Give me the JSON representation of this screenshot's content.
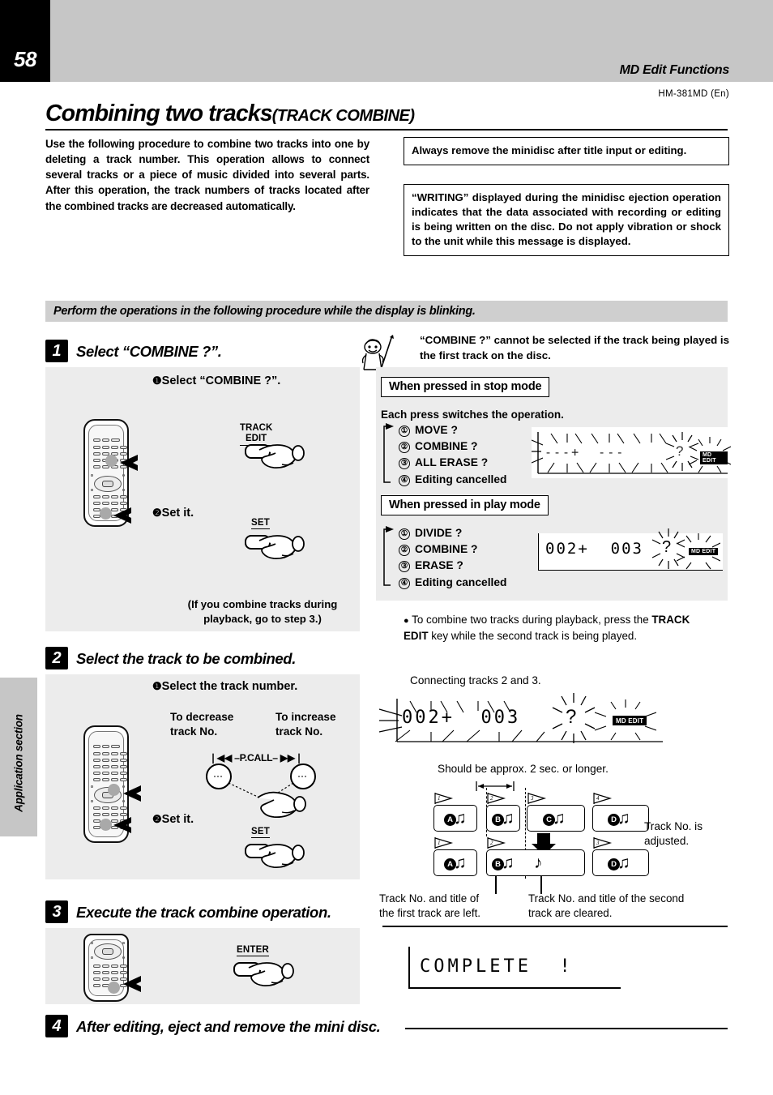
{
  "header": {
    "page_number": "58",
    "section_title": "MD Edit Functions",
    "model": "HM-381MD (En)"
  },
  "sidebar": {
    "label": "Application section"
  },
  "title": {
    "main": "Combining two tracks",
    "sub": "(TRACK COMBINE)"
  },
  "intro": "Use the following procedure to combine two tracks into one by deleting a track number. This operation allows to connect several tracks or a piece of music divided into several parts. After this operation, the track numbers of tracks located after the combined tracks are decreased automatically.",
  "notes": [
    "Always remove the minidisc after title input or editing.",
    "“WRITING” displayed during the minidisc ejection operation indicates that the data associated with recording or editing is being written on the disc. Do not apply vibration or shock to the unit while this message is displayed."
  ],
  "banner": "Perform the operations in the following procedure while the display is blinking.",
  "steps": [
    {
      "number": "1",
      "title": "Select “COMBINE ?”."
    },
    {
      "number": "2",
      "title": "Select the track to be combined."
    },
    {
      "number": "3",
      "title": "Execute the track combine operation."
    },
    {
      "number": "4",
      "title": "After editing, eject and remove the mini disc."
    }
  ],
  "step1": {
    "caution": "“COMBINE ?” cannot be selected if the track being played is the first track on the disc.",
    "sub1_num": "❶",
    "sub1": "Select “COMBINE ?”.",
    "sub2_num": "❷",
    "sub2": "Set it.",
    "key_track_edit_line1": "TRACK",
    "key_track_edit_line2": "EDIT",
    "key_set": "SET",
    "footnote": "(If you combine tracks during playback, go to step 3.)",
    "stop_mode_box": "When pressed in stop mode",
    "stop_mode_intro": "Each press switches the operation.",
    "stop_mode_options": [
      {
        "num": "①",
        "label": "MOVE ?"
      },
      {
        "num": "②",
        "label": "COMBINE ?"
      },
      {
        "num": "③",
        "label": "ALL ERASE ?"
      },
      {
        "num": "④",
        "label": "Editing cancelled"
      }
    ],
    "stop_mode_display": "---+  ---",
    "stop_mode_display_q": "?",
    "play_mode_box": "When pressed in play mode",
    "play_mode_options": [
      {
        "num": "①",
        "label": "DIVIDE ?"
      },
      {
        "num": "②",
        "label": "COMBINE ?"
      },
      {
        "num": "③",
        "label": "ERASE ?"
      },
      {
        "num": "④",
        "label": "Editing cancelled"
      }
    ],
    "play_mode_display": "002+  003",
    "play_mode_display_q": "?",
    "md_edit_badge": "MD EDIT",
    "tip_bullet": "●",
    "tip_part1": "To combine two tracks during playback, press the ",
    "tip_bold1": "TRACK",
    "tip_bold2": "EDIT",
    "tip_part2": " key while the second track is being played."
  },
  "step2": {
    "sub1_num": "❶",
    "sub1": "Select the track number.",
    "sub2_num": "❷",
    "sub2": "Set it.",
    "decrease_l1": "To decrease",
    "decrease_l2": "track No.",
    "increase_l1": "To increase",
    "increase_l2": "track No.",
    "pcall_label": "❘◀◀ –P.CALL– ▶▶❘",
    "key_set": "SET",
    "connecting_caption": "Connecting tracks 2 and 3.",
    "display": "002+  003",
    "display_q": "?",
    "md_edit_badge": "MD EDIT",
    "duration_note": "Should be approx. 2 sec. or longer.",
    "adjusted_l1": "Track No. is",
    "adjusted_l2": "adjusted.",
    "caption_left_l1": "Track No. and title of",
    "caption_left_l2": "the first track are left.",
    "caption_right_l1": "Track No. and title of the second",
    "caption_right_l2": "track are cleared.",
    "tracks_before": [
      {
        "flag": "1",
        "letter": "A"
      },
      {
        "flag": "2",
        "letter": "B"
      },
      {
        "flag": "3",
        "letter": "C"
      },
      {
        "flag": "4",
        "letter": "D"
      }
    ],
    "tracks_after": [
      {
        "flag": "1",
        "letter": "A"
      },
      {
        "flag": "2",
        "letter": "B"
      },
      {
        "flag": "",
        "letter": ""
      },
      {
        "flag": "3",
        "letter": "D"
      }
    ]
  },
  "step3": {
    "key_enter": "ENTER",
    "complete_display": "COMPLETE  !"
  },
  "colors": {
    "header_gray": "#c6c6c6",
    "panel_gray": "#ececec",
    "banner_gray": "#cfcfcf",
    "black": "#000000"
  }
}
